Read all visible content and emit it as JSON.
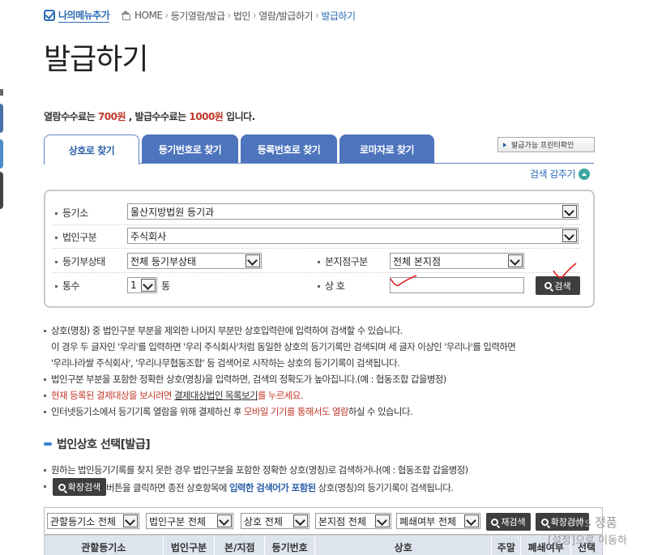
{
  "top": {
    "my_menu_label": "나의메뉴추가",
    "breadcrumb": [
      "HOME",
      "등기열람/발급",
      "법인",
      "열람/발급하기",
      "발급하기"
    ]
  },
  "page_title": "발급하기",
  "fee": {
    "prefix": "열람수수료는",
    "view_fee": "700원",
    "middle": ", 발급수수료는",
    "issue_fee": "1000원",
    "suffix": "입니다."
  },
  "tabs": [
    {
      "label": "상호로 찾기",
      "active": true
    },
    {
      "label": "등기번호로 찾기",
      "active": false
    },
    {
      "label": "등록번호로 찾기",
      "active": false
    },
    {
      "label": "로마자로 찾기",
      "active": false
    }
  ],
  "printer_button_label": "발급가능 프린터확인",
  "collapse_label": "검색 감추기",
  "search_form": {
    "registry_office": {
      "label": "등기소",
      "value": "울산지방법원 등기과"
    },
    "corp_type": {
      "label": "법인구분",
      "value": "주식회사"
    },
    "registry_status": {
      "label": "등기부상태",
      "value": "전체 등기부상태"
    },
    "branch_type": {
      "label": "본지점구분",
      "value": "전체 본지점"
    },
    "copies": {
      "label": "통수",
      "value": "1",
      "unit": "통"
    },
    "trade_name": {
      "label": "상 호",
      "value": ""
    },
    "search_button": "검색"
  },
  "notes": [
    {
      "text": "상호(명칭) 중 법인구분 부분을 제외한 나머지 부분만 상호입력란에 입력하여 검색할 수 있습니다.",
      "bullet": true
    },
    {
      "text": "이 경우 두 글자인 '우리'를 입력하면 '우리 주식회사'처럼 동일한 상호의 등기기록만 검색되며 세 글자 이상인 '우리나'를 입력하면",
      "bullet": false
    },
    {
      "text": "'우리나라쌀 주식회사', '우리나무협동조합' 등 검색어로 시작하는 상호의 등기기록이 검색됩니다.",
      "bullet": false
    },
    {
      "text": "법인구분 부분을 포함한 정확한 상호(명칭)을 입력하면, 검색의 정확도가 높아집니다.(예 : 협동조합 갑을병정)",
      "bullet": true
    }
  ],
  "note5": {
    "red1": "현재 등록된 결제대상을 보시려면 ",
    "link": "결제대상법인 목록보기",
    "red2": "를 누르세요."
  },
  "note6": {
    "t1": "인터넷등기소에서 등기기록 열람을 위해 결제하신 후 ",
    "red": "모바일 기기를 통해서도 열람",
    "t2": "하실 수 있습니다."
  },
  "section2": {
    "title": "법인상호 선택[발급]",
    "note1": "원하는 법인등기기록를 찾지 못한 경우 법인구분을 포함한 정확한 상호(명칭)로 검색하거나(예 : 협동조합 갑을병정)",
    "expand_button": "확장검색",
    "note2_a": " 버튼을 클릭하면 종전 상호항목에 ",
    "note2_b": "입력한 검색어가 포함된",
    "note2_c": " 상호(명칭)의 등기기록이 검색됩니다."
  },
  "filters": [
    "관할등기소 전체",
    "법인구분 전체",
    "상호 전체",
    "본지점 전체",
    "폐쇄여부 전체"
  ],
  "filter_buttons": {
    "research": "재검색",
    "expand": "확장검색"
  },
  "table_headers": [
    "관할등기소",
    "법인구분",
    "본/지점",
    "등기번호",
    "상호",
    "주말",
    "폐쇄여부",
    "선택"
  ],
  "watermark": {
    "line1": "ows 정품",
    "line2": "[설정]으로 이동하"
  },
  "colors": {
    "tab_blue": "#4d74bd",
    "accent_red": "#c0392b",
    "link_blue": "#2b6bb5",
    "button_dark": "#3e3e3e"
  }
}
